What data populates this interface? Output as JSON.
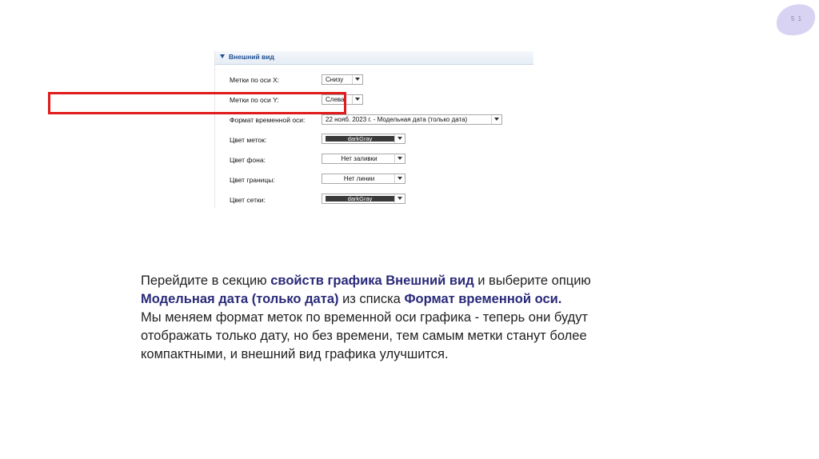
{
  "page_number": "5 1",
  "panel": {
    "section_title": "Внешний вид",
    "rows": [
      {
        "label": "Метки по оси X:",
        "value": "Снизу"
      },
      {
        "label": "Метки по оси Y:",
        "value": "Слева"
      },
      {
        "label": "Формат временной оси:",
        "value": "22 нояб. 2023 г. - Модельная дата (только дата)"
      },
      {
        "label": "Цвет меток:",
        "value": "darkGray"
      },
      {
        "label": "Цвет фона:",
        "value": "Нет заливки"
      },
      {
        "label": "Цвет границы:",
        "value": "Нет линии"
      },
      {
        "label": "Цвет сетки:",
        "value": "darkGray"
      }
    ]
  },
  "colors": {
    "highlight": "#e01b1b",
    "accent_text": "#2a2a7a",
    "page_blob": "#d9d3f3",
    "swatch": "#3a3a3a"
  },
  "description": {
    "p1": "Перейдите в секцию ",
    "p2": "свойств графика Внешний вид",
    "p3": " и выберите опцию",
    "p4": "Модельная дата (только дата)",
    "p5": " из списка ",
    "p6": "Формат временной оси.",
    "line3": "Мы меняем формат меток по временной оси графика - теперь они будут",
    "line4": "отображать только дату, но без времени, тем самым метки станут более",
    "line5": "компактными, и внешний вид графика улучшится."
  }
}
